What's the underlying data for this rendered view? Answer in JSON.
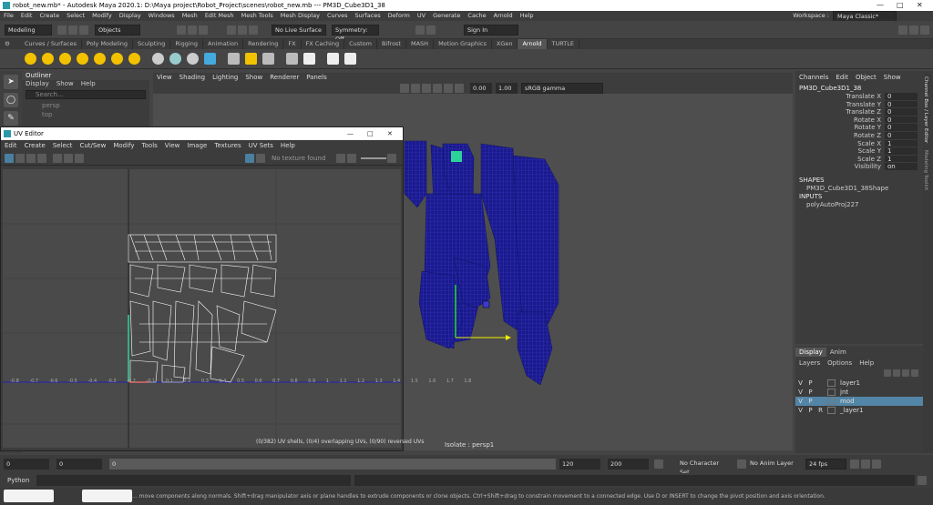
{
  "title_bar": {
    "text": "robot_new.mb* - Autodesk Maya 2020.1: D:\\Maya project\\Robot_Project\\scenes\\robot_new.mb   ---   PM3D_Cube3D1_38"
  },
  "menu": [
    "File",
    "Edit",
    "Create",
    "Select",
    "Modify",
    "Display",
    "Windows",
    "Mesh",
    "Edit Mesh",
    "Mesh Tools",
    "Mesh Display",
    "Curves",
    "Surfaces",
    "Deform",
    "UV",
    "Generate",
    "Cache",
    "Arnold",
    "Help"
  ],
  "workspace": {
    "label": "Workspace :",
    "value": "Maya Classic*"
  },
  "status": {
    "mode": "Modeling",
    "objects": "Objects",
    "live_surface": "No Live Surface",
    "symmetry": "Symmetry: Off",
    "sign_in": "Sign In"
  },
  "shelf_tabs": [
    "Curves / Surfaces",
    "Poly Modeling",
    "Sculpting",
    "Rigging",
    "Animation",
    "Rendering",
    "FX",
    "FX Caching",
    "Custom",
    "Bifrost",
    "MASH",
    "Motion Graphics",
    "XGen",
    "Arnold",
    "TURTLE"
  ],
  "shelf_active": "Arnold",
  "outliner": {
    "title": "Outliner",
    "menu": [
      "Display",
      "Show",
      "Help"
    ],
    "search": "Search...",
    "items": [
      "persp",
      "top"
    ]
  },
  "viewport": {
    "menu": [
      "View",
      "Shading",
      "Lighting",
      "Show",
      "Renderer",
      "Panels"
    ],
    "val1": "0.00",
    "val2": "1.00",
    "colorspace": "sRGB gamma",
    "label": "Isolate : persp1"
  },
  "uv_editor": {
    "title": "UV Editor",
    "menu": [
      "Edit",
      "Create",
      "Select",
      "Cut/Sew",
      "Modify",
      "Tools",
      "View",
      "Image",
      "Textures",
      "UV Sets",
      "Help"
    ],
    "texture": "No texture found",
    "status": "(0/382) UV shells, (0/4) overlapping UVs, (0/90) reversed UVs",
    "axis_labels": [
      "-0.8",
      "-0.7",
      "-0.6",
      "-0.5",
      "-0.4",
      "-0.3",
      "-0.2",
      "-0.1",
      "0.1",
      "0.2",
      "0.3",
      "0.4",
      "0.5",
      "0.6",
      "0.7",
      "0.8",
      "0.9",
      "1",
      "1.1",
      "1.2",
      "1.3",
      "1.4",
      "1.5",
      "1.6",
      "1.7",
      "1.8"
    ]
  },
  "channel_box": {
    "menu": [
      "Channels",
      "Edit",
      "Object",
      "Show"
    ],
    "object": "PM3D_Cube3D1_38",
    "channels": [
      {
        "name": "Translate X",
        "value": "0"
      },
      {
        "name": "Translate Y",
        "value": "0"
      },
      {
        "name": "Translate Z",
        "value": "0"
      },
      {
        "name": "Rotate X",
        "value": "0"
      },
      {
        "name": "Rotate Y",
        "value": "0"
      },
      {
        "name": "Rotate Z",
        "value": "0"
      },
      {
        "name": "Scale X",
        "value": "1"
      },
      {
        "name": "Scale Y",
        "value": "1"
      },
      {
        "name": "Scale Z",
        "value": "1"
      },
      {
        "name": "Visibility",
        "value": "on"
      }
    ],
    "shapes_header": "SHAPES",
    "shape": "PM3D_Cube3D1_38Shape",
    "inputs_header": "INPUTS",
    "input": "polyAutoProj227"
  },
  "side_tabs": [
    "Channel Box / Layer Editor",
    "Modeling Toolkit"
  ],
  "layers": {
    "tabs": [
      "Display",
      "Anim"
    ],
    "menu": [
      "Layers",
      "Options",
      "Help"
    ],
    "rows": [
      {
        "v": "V",
        "p": "P",
        "r": "",
        "name": "layer1",
        "selected": false
      },
      {
        "v": "V",
        "p": "P",
        "r": "",
        "name": "jnt",
        "selected": false
      },
      {
        "v": "V",
        "p": "P",
        "r": "",
        "name": "mod",
        "selected": true
      },
      {
        "v": "V",
        "p": "P",
        "r": "R",
        "name": "_layer1",
        "selected": false
      }
    ]
  },
  "timeline": {
    "start": "0",
    "range_start": "0",
    "range_inner": "0",
    "current": "120",
    "end": "200",
    "character_set": "No Character Set",
    "anim_layer": "No Anim Layer",
    "fps": "24 fps"
  },
  "command": {
    "lang": "Python"
  },
  "help": "... move components along normals. Shift+drag manipulator axis or plane handles to extrude components or clone objects. Ctrl+Shift+drag to constrain movement to a connected edge. Use D or INSERT to change the pivot position and axis orientation.",
  "colors": {
    "wire": "#1a1a8c",
    "layer_selected": "#5285a6",
    "uv_wire": "#ffffff"
  }
}
